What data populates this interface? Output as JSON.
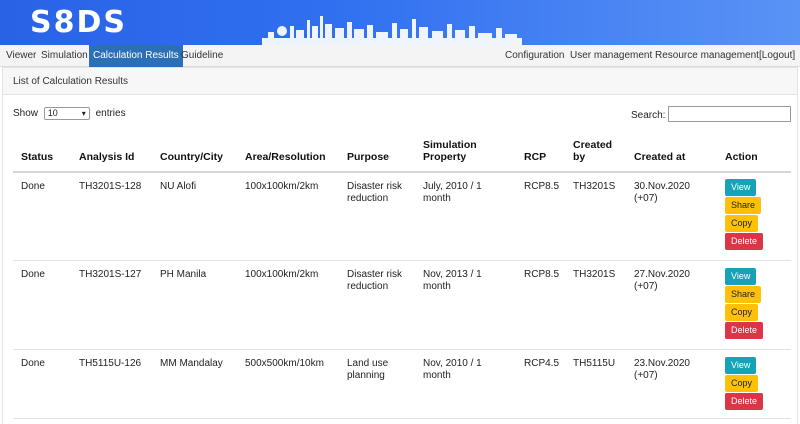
{
  "app": {
    "logo": "S8DS"
  },
  "nav": {
    "left": [
      "Viewer",
      "Simulation",
      "Calculation Results",
      "Guideline"
    ],
    "right": [
      "Configuration",
      "User management",
      "Resource management",
      "[Logout]"
    ]
  },
  "panel": {
    "title": "List of Calculation Results"
  },
  "controls": {
    "show_label": "Show",
    "entries_value": "10",
    "entries_label": "entries",
    "search_label": "Search:",
    "search_value": ""
  },
  "table": {
    "headers": {
      "status": "Status",
      "analysis_id": "Analysis Id",
      "country_city": "Country/City",
      "area_resolution": "Area/Resolution",
      "purpose": "Purpose",
      "sim_property_1": "Simulation",
      "sim_property_2": "Property",
      "rcp": "RCP",
      "created_by_1": "Created",
      "created_by_2": "by",
      "created_at": "Created at",
      "action": "Action"
    },
    "rows": [
      {
        "status": "Done",
        "analysis_id": "TH3201S-128",
        "country_city": "NU Alofi",
        "area_resolution": "100x100km/2km",
        "purpose_1": "Disaster risk",
        "purpose_2": "reduction",
        "sim_1": "July, 2010 / 1",
        "sim_2": "month",
        "rcp": "RCP8.5",
        "created_by": "TH3201S",
        "created_at_1": "30.Nov.2020",
        "created_at_2": "(+07)"
      },
      {
        "status": "Done",
        "analysis_id": "TH3201S-127",
        "country_city": "PH Manila",
        "area_resolution": "100x100km/2km",
        "purpose_1": "Disaster risk",
        "purpose_2": "reduction",
        "sim_1": "Nov, 2013 / 1",
        "sim_2": "month",
        "rcp": "RCP8.5",
        "created_by": "TH3201S",
        "created_at_1": "27.Nov.2020",
        "created_at_2": "(+07)"
      },
      {
        "status": "Done",
        "analysis_id": "TH5115U-126",
        "country_city": "MM Mandalay",
        "area_resolution": "500x500km/10km",
        "purpose_1": "Land use",
        "purpose_2": "planning",
        "sim_1": "Nov, 2010 / 1",
        "sim_2": "month",
        "rcp": "RCP4.5",
        "created_by": "TH5115U",
        "created_at_1": "23.Nov.2020",
        "created_at_2": "(+07)"
      }
    ]
  },
  "actions": {
    "view": "View",
    "share": "Share",
    "copy": "Copy",
    "delete": "Delete"
  },
  "colors": {
    "banner": "#2f6ff0",
    "nav_active": "#2b6fb6",
    "view": "#17a2b8",
    "share": "#ffc107",
    "delete": "#dc3545"
  }
}
